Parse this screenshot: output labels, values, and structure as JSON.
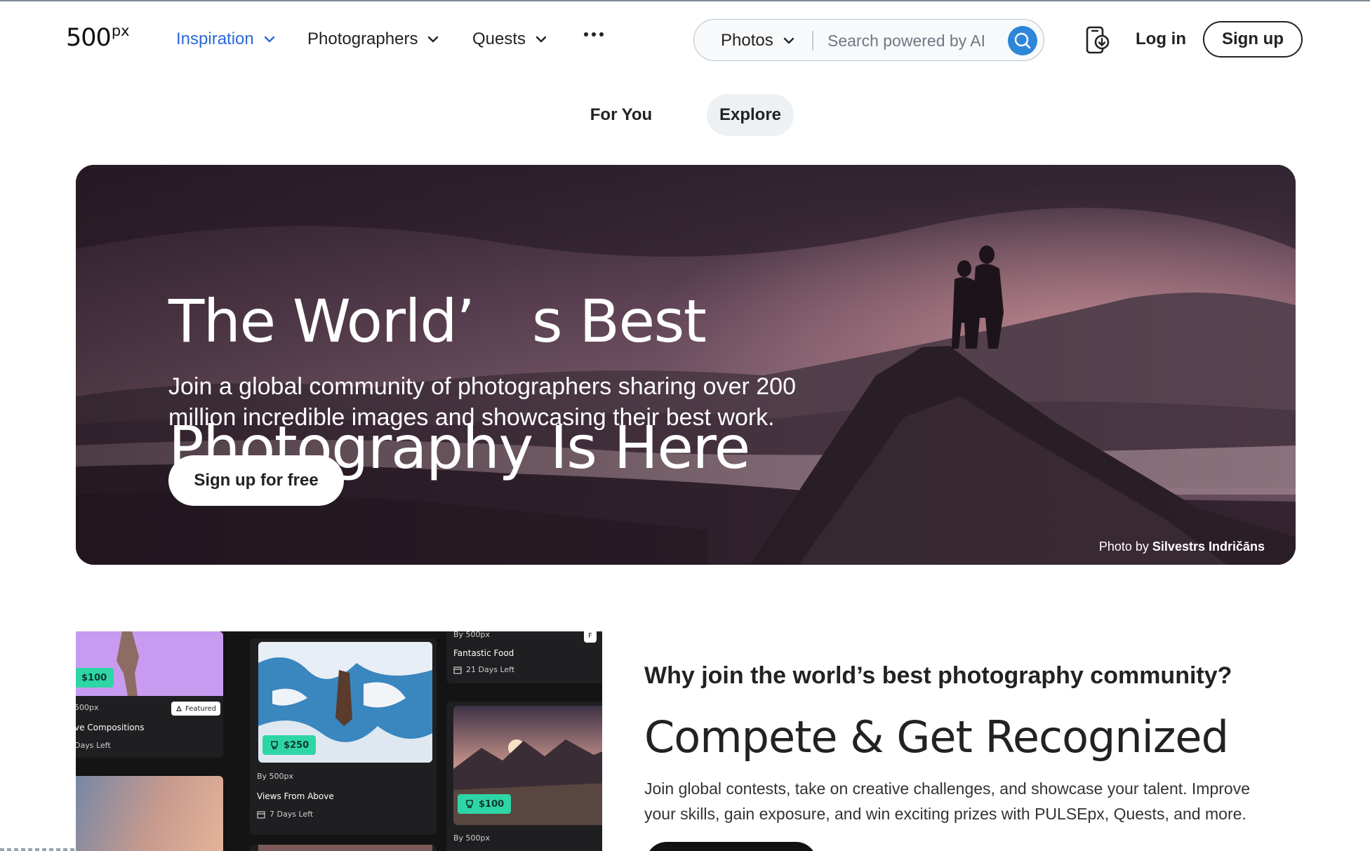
{
  "header": {
    "logo_main": "500",
    "logo_sup": "px",
    "nav": [
      {
        "label": "Inspiration",
        "active": true
      },
      {
        "label": "Photographers",
        "active": false
      },
      {
        "label": "Quests",
        "active": false
      }
    ],
    "search": {
      "scope": "Photos",
      "placeholder": "Search powered by AI"
    },
    "login": "Log in",
    "signup": "Sign up"
  },
  "tabs": [
    {
      "label": "For You",
      "selected": false
    },
    {
      "label": "Explore",
      "selected": true
    }
  ],
  "hero": {
    "title_line1": "The World’ s Best",
    "title_line2": "Photography Is Here",
    "subtitle_line1": "Join a global community of photographers sharing over 200",
    "subtitle_line2": "million incredible images and showcasing their best work.",
    "cta": "Sign up for free",
    "credit_prefix": "Photo by",
    "credit_name": "Silvestrs Indričāns"
  },
  "collage": {
    "cards": [
      {
        "prize": "$100",
        "by": "500px",
        "featured": "Featured",
        "title": "ve Compositions",
        "days": "Days Left"
      },
      {
        "prize": "$250",
        "by": "By 500px",
        "title": "Views From Above",
        "days": "7 Days Left"
      },
      {
        "by": "By 500px",
        "title": "Fantastic Food",
        "days": "21 Days Left",
        "featured": "F"
      },
      {
        "prize": "$100",
        "by": "By 500px"
      }
    ]
  },
  "section": {
    "why": "Why join the world’s best photography community?",
    "heading": "Compete & Get Recognized",
    "body_line1": "Join global contests, take on creative challenges, and showcase your talent. Improve",
    "body_line2": "your skills, gain exposure, and win exciting prizes with PULSEpx, Quests, and more."
  },
  "colors": {
    "accent_blue": "#2a6ad8",
    "search_button": "#2e86d8",
    "prize_green": "#2ed6a5",
    "text_dark": "#222222"
  },
  "icons": [
    "chevron-down-icon",
    "more-dots-icon",
    "search-icon",
    "app-download-icon",
    "trophy-icon",
    "calendar-icon",
    "rocket-icon"
  ]
}
